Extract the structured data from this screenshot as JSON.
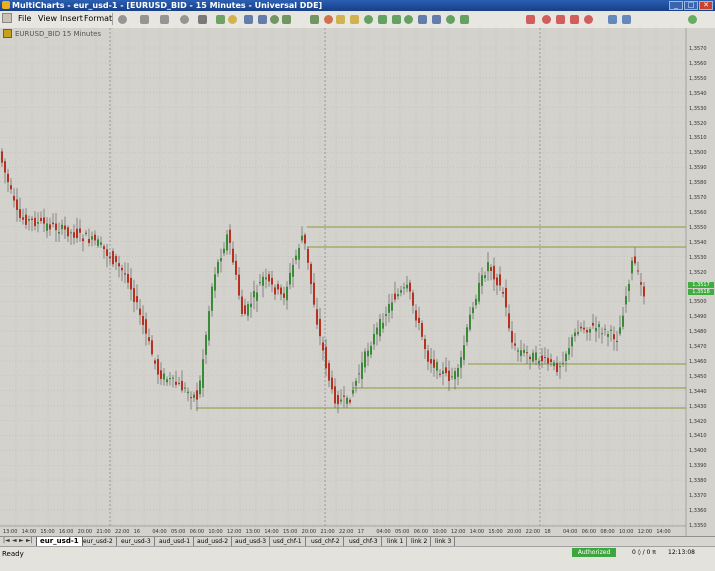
{
  "window": {
    "title": "MultiCharts - eur_usd-1 - [EURUSD_BID - 15 Minutes - Universal DDE]",
    "buttons": [
      "_",
      "□",
      "✕"
    ]
  },
  "menu": {
    "items": [
      "File",
      "View",
      "Insert",
      "Format"
    ]
  },
  "toolbar": {
    "icons": [
      "new-window-icon",
      "minimize-icon",
      "restore-icon",
      "close-doc-icon",
      "chevron-icon",
      "chart-type-icon",
      "drawing-icon",
      "cursor-icon",
      "crosshair-icon",
      "volume-icon",
      "bar-icon",
      "candle-icon",
      "hourglass-icon",
      "arrow-left-icon",
      "arrow-right-icon",
      "circle-icon",
      "diamond-icon",
      "prev-icon",
      "next-icon",
      "zoom-in-icon",
      "zoom-out-icon",
      "refresh-icon",
      "pan-icon",
      "trendline-icon",
      "horizontal-line-icon",
      "vertical-line-icon",
      "ray-icon",
      "fib-icon",
      "channel-icon",
      "text-icon",
      "more-icon"
    ]
  },
  "chart": {
    "symbol": "EURUSD_BID",
    "resolution": "15 Minutes",
    "colors": {
      "up": "#3a8a3a",
      "down": "#b83020",
      "level_line": "#8a9a3a",
      "grid": "#bcbab4",
      "badge": "#3fae3f"
    },
    "price_ticks": [
      "1,3570",
      "1,3560",
      "1,3550",
      "1,3540",
      "1,3530",
      "1,3520",
      "1,3510",
      "1,3500",
      "1,3590",
      "1,3580",
      "1,3570",
      "1,3560",
      "1,3550",
      "1,3540",
      "1,3530",
      "1,3520",
      "1,3510",
      "1,3500",
      "1,3490",
      "1,3480",
      "1,3470",
      "1,3460",
      "1,3450",
      "1,3440",
      "1,3430",
      "1,3420",
      "1,3410",
      "1,3400",
      "1,3390",
      "1,3380",
      "1,3370",
      "1,3360",
      "1,3350"
    ],
    "price_badges": [
      "1,3517",
      "1,3518"
    ],
    "time_ticks": [
      "13:00",
      "14:00",
      "15:00",
      "16:00",
      "20:00",
      "21:00",
      "22:00",
      "16",
      "04:00",
      "05:00",
      "06:00",
      "10:00",
      "12:00",
      "13:00",
      "14:00",
      "15:00",
      "20:00",
      "21:00",
      "22:00",
      "17",
      "04:00",
      "05:00",
      "06:00",
      "10:00",
      "12:00",
      "14:00",
      "15:00",
      "20:00",
      "22:00",
      "18",
      "04:00",
      "06:00",
      "08:00",
      "10:00",
      "12:00",
      "14:00"
    ]
  },
  "tabs": {
    "nav": [
      "|◄",
      "◄",
      "►",
      "►|"
    ],
    "items": [
      "eur_usd-1",
      "eur_usd-2",
      "eur_usd-3",
      "aud_usd-1",
      "aud_usd-2",
      "aud_usd-3",
      "usd_chf-1",
      "usd_chf-2",
      "usd_chf-3",
      "link 1",
      "link 2",
      "link 3"
    ]
  },
  "status": {
    "text": "Ready",
    "badge": "Authorized",
    "count": "0 ◊ / 0 π",
    "time": "12:13:08"
  }
}
